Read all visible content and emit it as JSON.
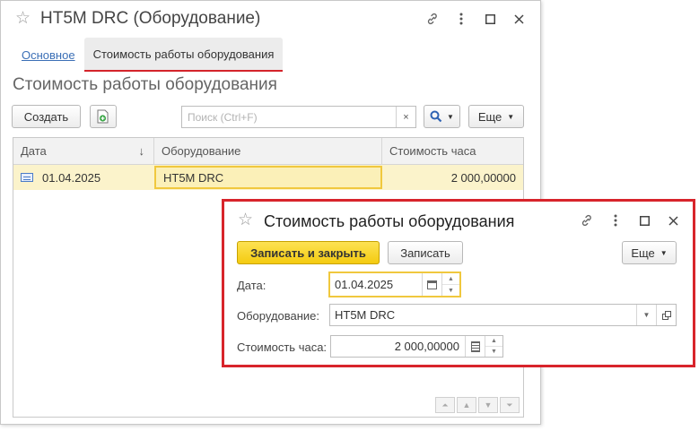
{
  "main_window": {
    "title": "HT5M DRC (Оборудование)",
    "header_icons": [
      "link-icon",
      "more-vertical-icon",
      "maximize-icon",
      "close-icon"
    ],
    "tabs": [
      {
        "label": "Основное",
        "active": false
      },
      {
        "label": "Стоимость работы оборудования",
        "active": true
      }
    ],
    "section_title": "Стоимость работы оборудования",
    "toolbar": {
      "create_label": "Создать",
      "search_placeholder": "Поиск (Ctrl+F)",
      "clear_icon": "×",
      "search_dropdown_icon": "search-icon",
      "more_label": "Еще"
    },
    "table": {
      "columns": [
        "Дата",
        "Оборудование",
        "Стоимость часа"
      ],
      "sort_indicator": "↓",
      "rows": [
        {
          "date": "01.04.2025",
          "equipment": "HT5M DRC",
          "cost": "2 000,00000"
        }
      ]
    }
  },
  "dialog": {
    "title": "Стоимость работы оборудования",
    "save_close_label": "Записать и закрыть",
    "save_label": "Записать",
    "more_label": "Еще",
    "fields": {
      "date_label": "Дата:",
      "date_value": "01.04.2025",
      "equipment_label": "Оборудование:",
      "equipment_value": "HT5M DRC",
      "cost_label": "Стоимость часа:",
      "cost_value": "2 000,00000"
    }
  },
  "colors": {
    "accent_red": "#d8242b",
    "primary_yellow": "#f4cb10",
    "selected_row": "#fbf3cb",
    "link_blue": "#3b6fb6"
  }
}
